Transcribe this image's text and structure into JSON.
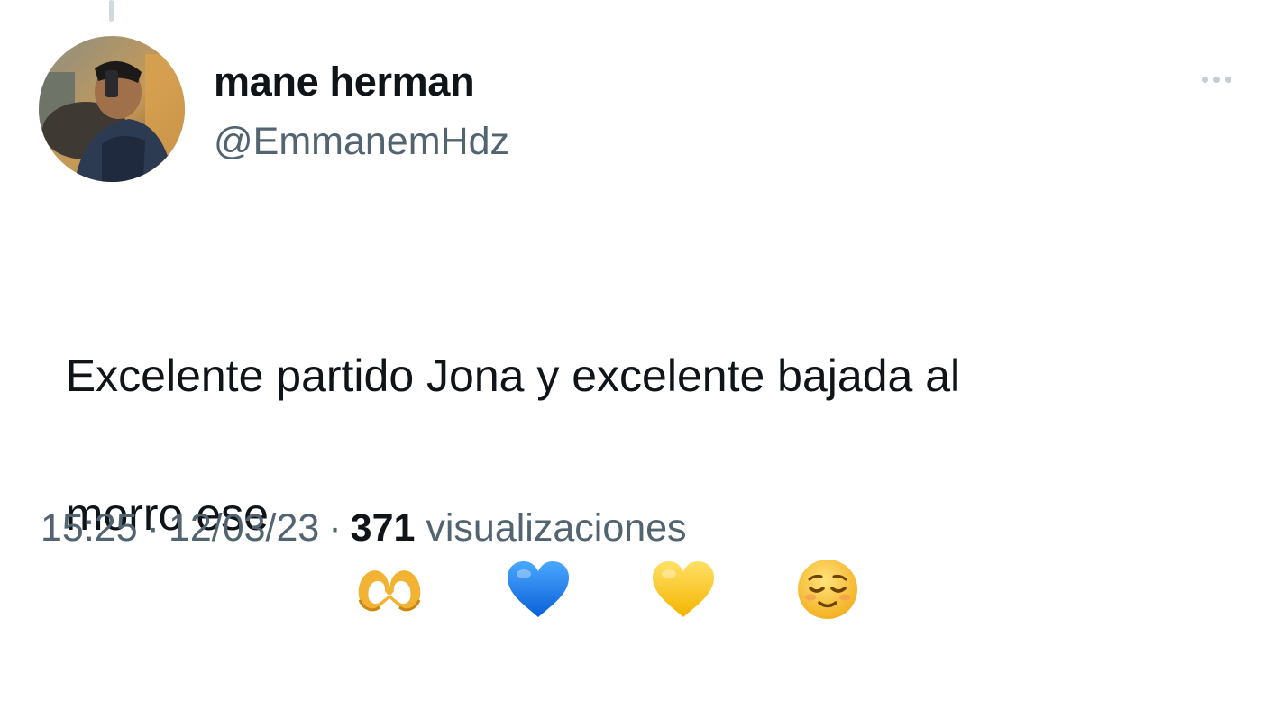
{
  "tweet": {
    "author": {
      "display_name": "mane herman",
      "handle": "@EmmanemHdz"
    },
    "text_line1": "Excelente partido Jona y excelente bajada al",
    "text_line2": "morro ese",
    "emojis": [
      "heart-hands-emoji",
      "blue-heart-emoji",
      "yellow-heart-emoji",
      "relieved-face-emoji"
    ],
    "time": "15:25",
    "date": "12/03/23",
    "separator": "·",
    "views_count": "371",
    "views_label": "visualizaciones",
    "more_icon": "more-horizontal-icon"
  },
  "colors": {
    "text_primary": "#0f1419",
    "text_secondary": "#536471",
    "blue_heart": "#1d7cf2",
    "yellow_heart": "#ffcd2e"
  }
}
